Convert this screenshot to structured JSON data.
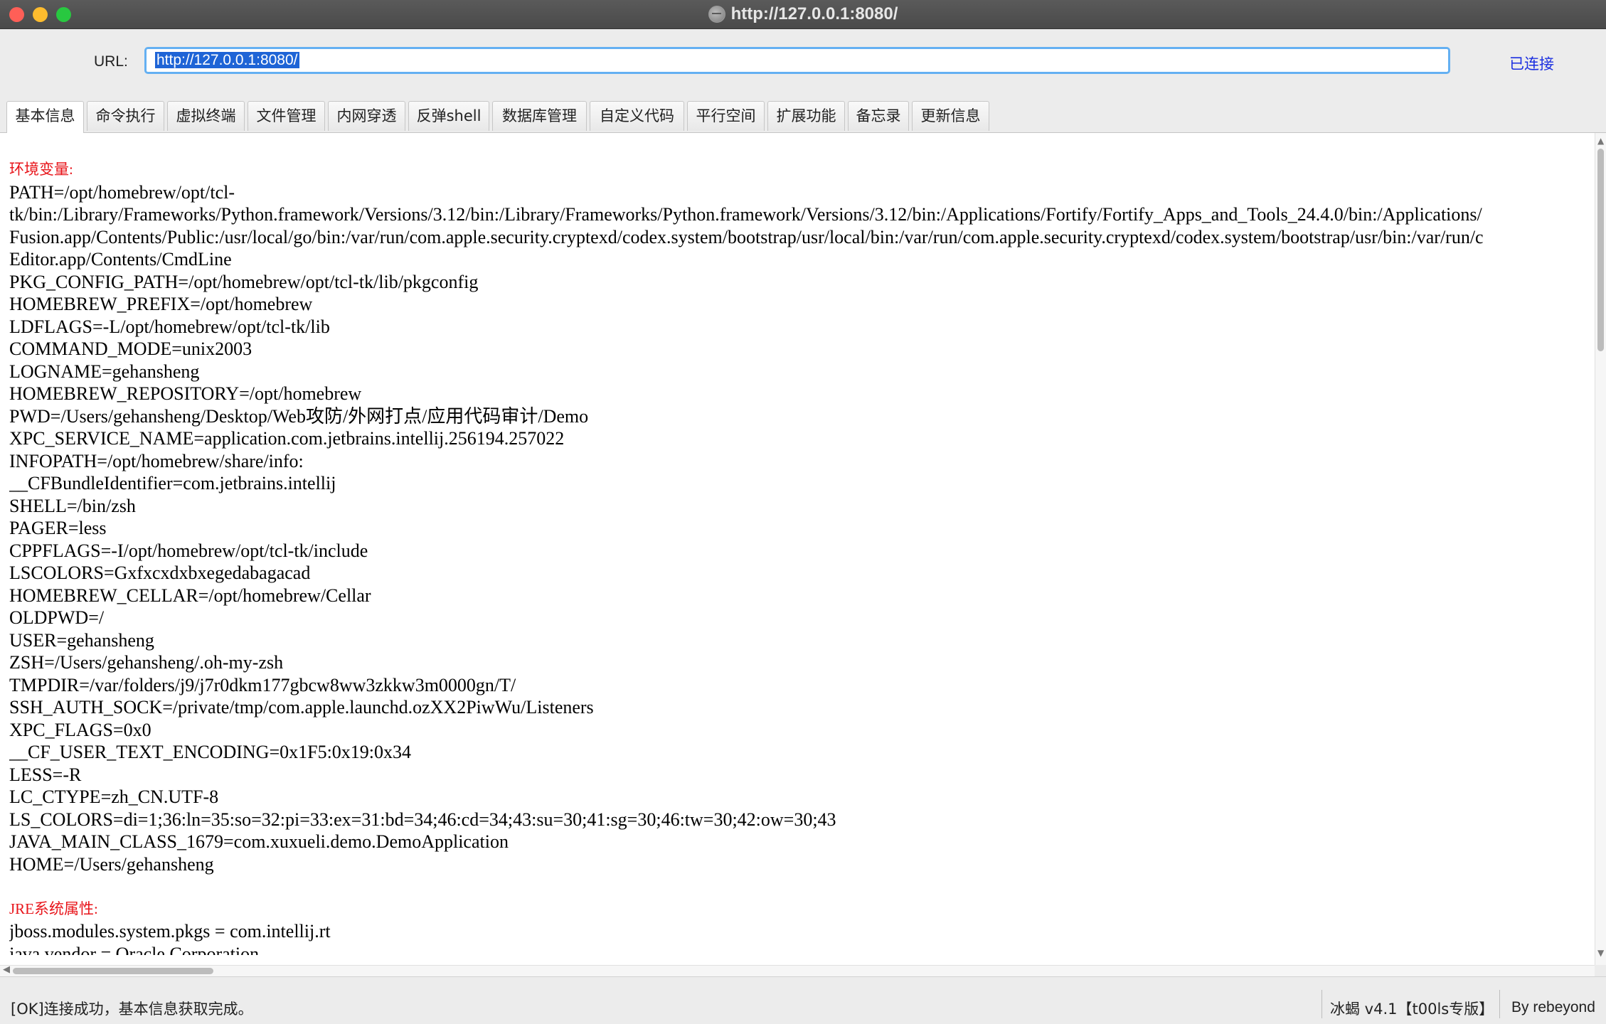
{
  "window": {
    "title": "http://127.0.0.1:8080/"
  },
  "url_bar": {
    "label": "URL:",
    "value": "http://127.0.0.1:8080/",
    "status": "已连接"
  },
  "tabs": [
    {
      "label": "基本信息",
      "active": true
    },
    {
      "label": "命令执行"
    },
    {
      "label": "虚拟终端"
    },
    {
      "label": "文件管理"
    },
    {
      "label": "内网穿透"
    },
    {
      "label": "反弹shell"
    },
    {
      "label": "数据库管理"
    },
    {
      "label": "自定义代码"
    },
    {
      "label": "平行空间"
    },
    {
      "label": "扩展功能"
    },
    {
      "label": "备忘录"
    },
    {
      "label": "更新信息"
    }
  ],
  "content": {
    "lines": [
      {
        "type": "head",
        "text": "环境变量:"
      },
      {
        "text": "PATH=/opt/homebrew/opt/tcl-"
      },
      {
        "text": "tk/bin:/Library/Frameworks/Python.framework/Versions/3.12/bin:/Library/Frameworks/Python.framework/Versions/3.12/bin:/Applications/Fortify/Fortify_Apps_and_Tools_24.4.0/bin:/Applications/"
      },
      {
        "text": "Fusion.app/Contents/Public:/usr/local/go/bin:/var/run/com.apple.security.cryptexd/codex.system/bootstrap/usr/local/bin:/var/run/com.apple.security.cryptexd/codex.system/bootstrap/usr/bin:/var/run/c"
      },
      {
        "text": "Editor.app/Contents/CmdLine"
      },
      {
        "text": "PKG_CONFIG_PATH=/opt/homebrew/opt/tcl-tk/lib/pkgconfig"
      },
      {
        "text": "HOMEBREW_PREFIX=/opt/homebrew"
      },
      {
        "text": "LDFLAGS=-L/opt/homebrew/opt/tcl-tk/lib"
      },
      {
        "text": "COMMAND_MODE=unix2003"
      },
      {
        "text": "LOGNAME=gehansheng"
      },
      {
        "text": "HOMEBREW_REPOSITORY=/opt/homebrew"
      },
      {
        "text": "PWD=/Users/gehansheng/Desktop/Web攻防/外网打点/应用代码审计/Demo"
      },
      {
        "text": "XPC_SERVICE_NAME=application.com.jetbrains.intellij.256194.257022"
      },
      {
        "text": "INFOPATH=/opt/homebrew/share/info:"
      },
      {
        "text": "__CFBundleIdentifier=com.jetbrains.intellij"
      },
      {
        "text": "SHELL=/bin/zsh"
      },
      {
        "text": "PAGER=less"
      },
      {
        "text": "CPPFLAGS=-I/opt/homebrew/opt/tcl-tk/include"
      },
      {
        "text": "LSCOLORS=Gxfxcxdxbxegedabagacad"
      },
      {
        "text": "HOMEBREW_CELLAR=/opt/homebrew/Cellar"
      },
      {
        "text": "OLDPWD=/"
      },
      {
        "text": "USER=gehansheng"
      },
      {
        "text": "ZSH=/Users/gehansheng/.oh-my-zsh"
      },
      {
        "text": "TMPDIR=/var/folders/j9/j7r0dkm177gbcw8ww3zkkw3m0000gn/T/"
      },
      {
        "text": "SSH_AUTH_SOCK=/private/tmp/com.apple.launchd.ozXX2PiwWu/Listeners"
      },
      {
        "text": "XPC_FLAGS=0x0"
      },
      {
        "text": "__CF_USER_TEXT_ENCODING=0x1F5:0x19:0x34"
      },
      {
        "text": "LESS=-R"
      },
      {
        "text": "LC_CTYPE=zh_CN.UTF-8"
      },
      {
        "text": "LS_COLORS=di=1;36:ln=35:so=32:pi=33:ex=31:bd=34;46:cd=34;43:su=30;41:sg=30;46:tw=30;42:ow=30;43"
      },
      {
        "text": "JAVA_MAIN_CLASS_1679=com.xuxueli.demo.DemoApplication"
      },
      {
        "text": "HOME=/Users/gehansheng"
      },
      {
        "type": "blank",
        "text": ""
      },
      {
        "type": "head",
        "text": "JRE系统属性:"
      },
      {
        "text": "jboss.modules.system.pkgs = com.intellij.rt"
      },
      {
        "text": "java.vendor = Oracle Corporation"
      }
    ]
  },
  "status_bar": {
    "message": "[OK]连接成功，基本信息获取完成。",
    "version": "冰蝎 v4.1【t00ls专版】",
    "author": "By rebeyond"
  }
}
